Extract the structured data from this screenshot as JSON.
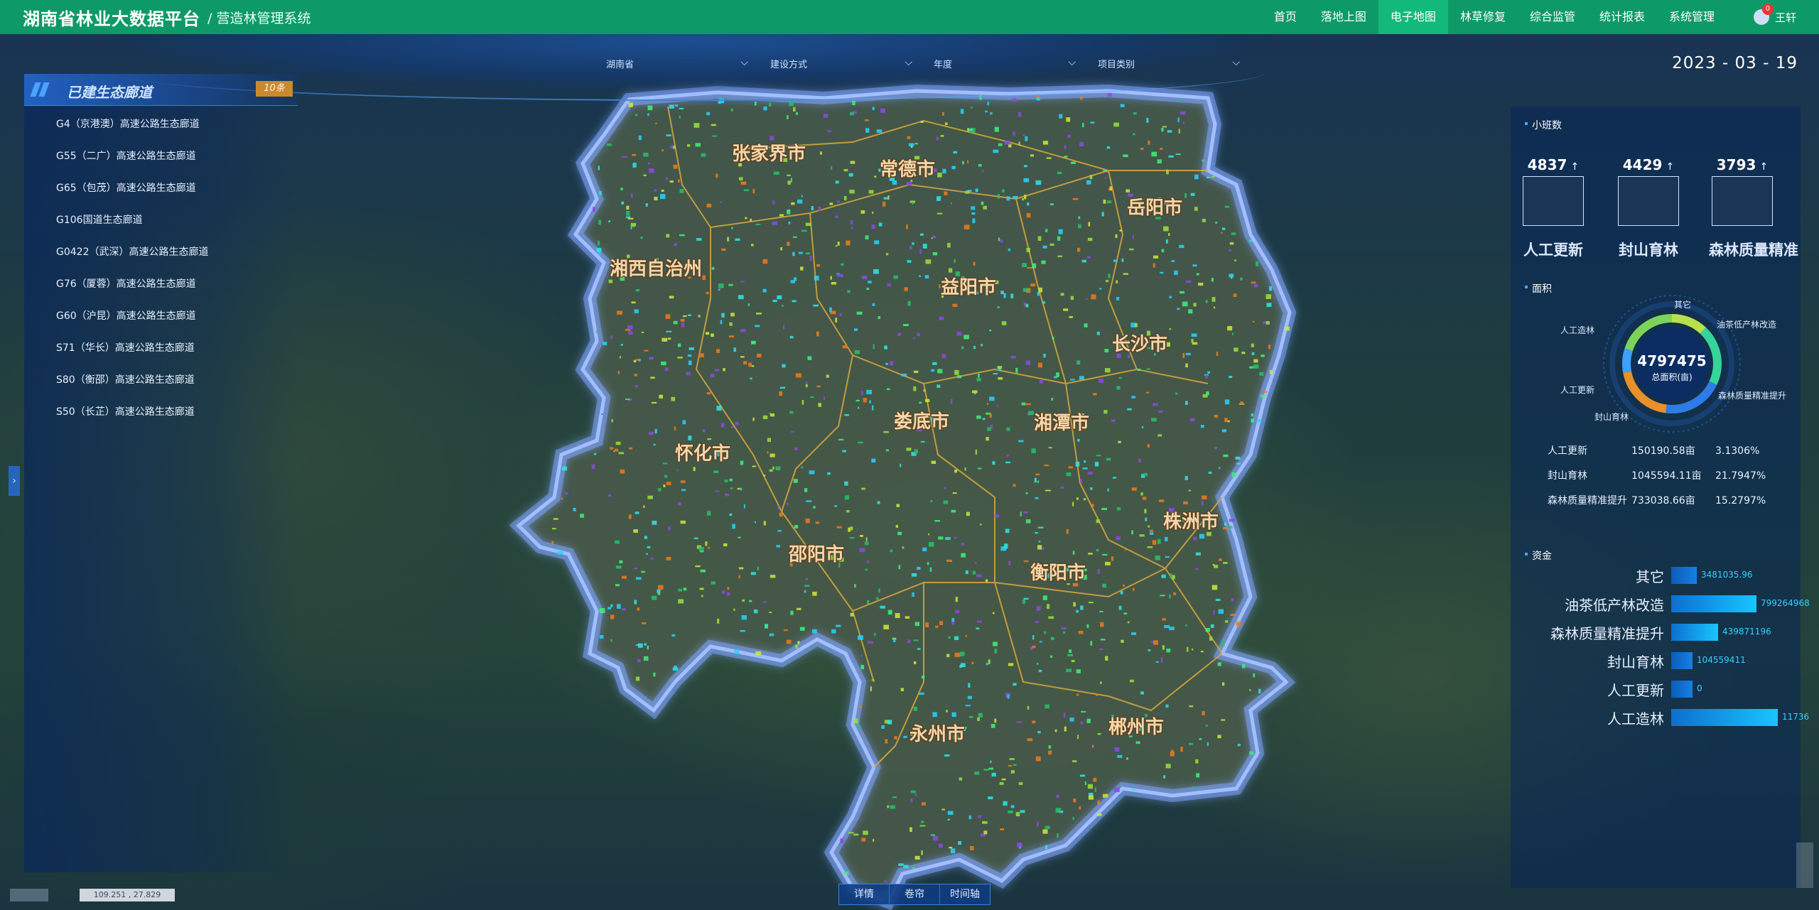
{
  "header": {
    "title": "湖南省林业大数据平台",
    "subtitle": "/ 营造林管理系统",
    "nav": [
      "首页",
      "落地上图",
      "电子地图",
      "林草修复",
      "综合监管",
      "统计报表",
      "系统管理"
    ],
    "active_nav": "电子地图",
    "user": "王轩",
    "badge": "0"
  },
  "filters": {
    "province": "湖南省",
    "method": "建设方式",
    "year": "年度",
    "category": "项目类别"
  },
  "date": "2023 - 03 - 19",
  "left_panel": {
    "title": "已建生态廊道",
    "count": "10条",
    "roads": [
      "G4（京港澳）高速公路生态廊道",
      "G55（二广）高速公路生态廊道",
      "G65（包茂）高速公路生态廊道",
      "G106国道生态廊道",
      "G0422（武深）高速公路生态廊道",
      "G76（厦蓉）高速公路生态廊道",
      "G60（沪昆）高速公路生态廊道",
      "S71（华长）高速公路生态廊道",
      "S80（衡邵）高速公路生态廊道",
      "S50（长芷）高速公路生态廊道"
    ]
  },
  "map": {
    "cities": [
      "张家界市",
      "常德市",
      "岳阳市",
      "湘西自治州",
      "益阳市",
      "长沙市",
      "娄底市",
      "湘潭市",
      "怀化市",
      "株洲市",
      "邵阳市",
      "衡阳市",
      "永州市",
      "郴州市"
    ],
    "coords": "109.251 , 27.829"
  },
  "right_panel": {
    "xiaoban_title": "小班数",
    "stats": [
      {
        "num": "4837",
        "label": "人工更新"
      },
      {
        "num": "4429",
        "label": "封山育林"
      },
      {
        "num": "3793",
        "label": "森林质量精准"
      }
    ],
    "area_title": "面积",
    "donut": {
      "total": "4797475",
      "unit": "总面积(亩)",
      "labels": [
        "其它",
        "油茶低产林改造",
        "森林质量精准提升",
        "封山育林",
        "人工更新",
        "人工造林"
      ],
      "colors": [
        "#b8e04a",
        "#35d49a",
        "#2e7ce8",
        "#e8902a",
        "#3da2ff",
        "#7dd35a"
      ]
    },
    "area_rows": [
      {
        "name": "人工更新",
        "area": "150190.58亩",
        "pct": "3.1306%"
      },
      {
        "name": "封山育林",
        "area": "1045594.11亩",
        "pct": "21.7947%"
      },
      {
        "name": "森林质量精准提升",
        "area": "733038.66亩",
        "pct": "15.2797%"
      }
    ],
    "fund_title": "资金",
    "funds": [
      {
        "name": "其它",
        "value": "3481035.96",
        "ratio": 0.24
      },
      {
        "name": "油茶低产林改造",
        "value": "799264968",
        "ratio": 0.8
      },
      {
        "name": "森林质量精准提升",
        "value": "439871196",
        "ratio": 0.44
      },
      {
        "name": "封山育林",
        "value": "104559411",
        "ratio": 0.2
      },
      {
        "name": "人工更新",
        "value": "0",
        "ratio": 0.2
      },
      {
        "name": "人工造林",
        "value": "11736",
        "ratio": 1.0
      }
    ]
  },
  "bottom": {
    "buttons": [
      "详情",
      "卷帘",
      "时间轴"
    ]
  }
}
